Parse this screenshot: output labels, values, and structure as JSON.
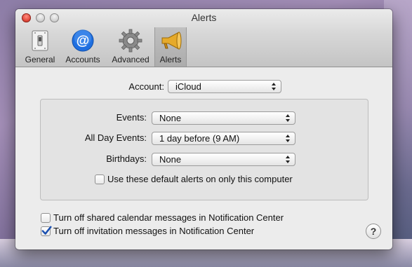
{
  "window": {
    "title": "Alerts"
  },
  "toolbar": {
    "items": [
      {
        "label": "General",
        "icon": "switch-icon"
      },
      {
        "label": "Accounts",
        "icon": "at-sign-icon"
      },
      {
        "label": "Advanced",
        "icon": "gear-icon"
      },
      {
        "label": "Alerts",
        "icon": "megaphone-icon",
        "selected": true
      }
    ]
  },
  "account": {
    "label": "Account:",
    "value": "iCloud"
  },
  "alerts": {
    "events": {
      "label": "Events:",
      "value": "None"
    },
    "all_day": {
      "label": "All Day Events:",
      "value": "1 day before (9 AM)"
    },
    "birthdays": {
      "label": "Birthdays:",
      "value": "None"
    },
    "use_default": {
      "label": "Use these default alerts on only this computer",
      "checked": false
    }
  },
  "options": {
    "shared_calendar": {
      "label": "Turn off shared calendar messages in Notification Center",
      "checked": false
    },
    "invitation": {
      "label": "Turn off invitation messages in Notification Center",
      "checked": true
    }
  },
  "help": {
    "label": "?"
  },
  "colors": {
    "checkmark": "#1a4fb0",
    "accounts_blue": "#1f6fe0",
    "megaphone_gold": "#d99a1c"
  }
}
